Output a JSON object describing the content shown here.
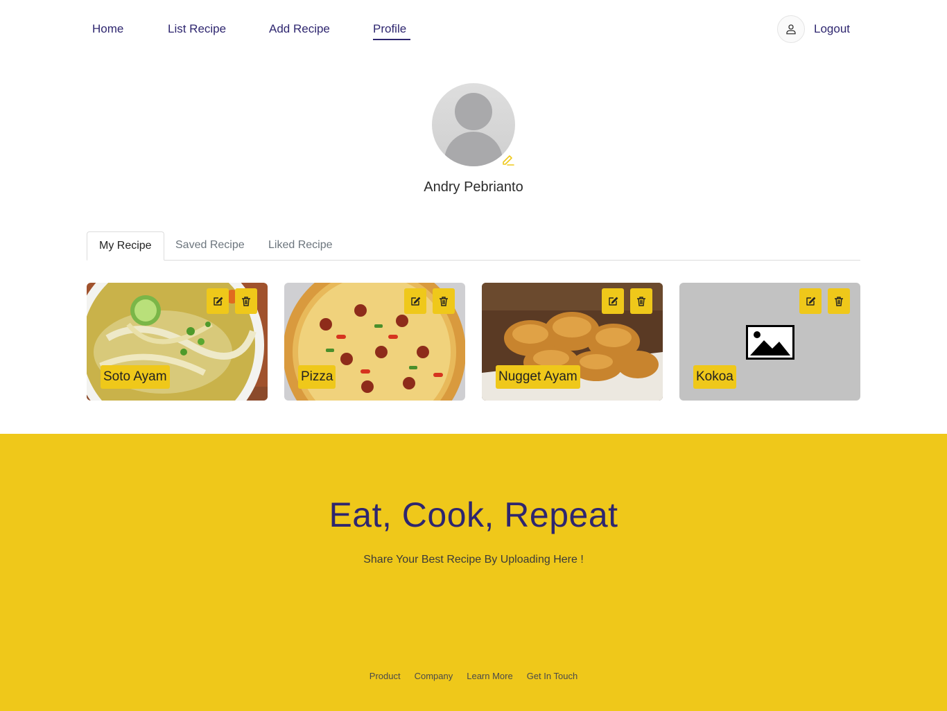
{
  "nav": {
    "items": [
      {
        "label": "Home"
      },
      {
        "label": "List Recipe"
      },
      {
        "label": "Add Recipe"
      },
      {
        "label": "Profile",
        "active": true
      }
    ],
    "logout_label": "Logout",
    "user_icon": "user-icon"
  },
  "profile": {
    "name": "Andry Pebrianto",
    "edit_icon": "pencil-icon"
  },
  "tabs": [
    {
      "label": "My Recipe",
      "active": true
    },
    {
      "label": "Saved Recipe"
    },
    {
      "label": "Liked Recipe"
    }
  ],
  "recipes": [
    {
      "title": "Soto Ayam",
      "image": "soup-photo"
    },
    {
      "title": "Pizza",
      "image": "pizza-photo"
    },
    {
      "title": "Nugget Ayam",
      "image": "nuggets-photo"
    },
    {
      "title": "Kokoa",
      "image": "image-placeholder"
    }
  ],
  "card_actions": {
    "edit_icon": "edit-icon",
    "delete_icon": "trash-icon"
  },
  "footer": {
    "heading": "Eat, Cook, Repeat",
    "subheading": "Share Your Best Recipe By Uploading Here !",
    "links": [
      "Product",
      "Company",
      "Learn More",
      "Get In Touch"
    ]
  },
  "colors": {
    "accent": "#efc81a",
    "primary_text": "#2e266f"
  }
}
